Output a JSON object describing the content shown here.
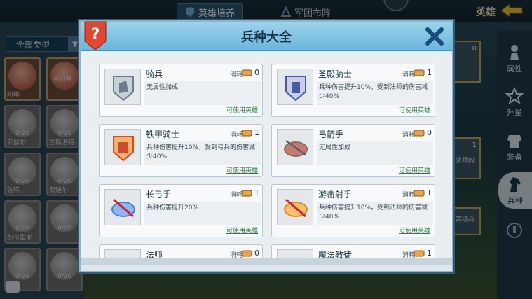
{
  "top_tabs": [
    {
      "label": "英雄培养",
      "icon": "shield-icon",
      "active": true
    },
    {
      "label": "军团布阵",
      "icon": "formation-icon",
      "active": false
    }
  ],
  "hero_title": "英雄",
  "filter": {
    "label": "全部类型"
  },
  "hero_cards": [
    {
      "name": "阿琳",
      "level": "",
      "highlight": true
    },
    {
      "name": "",
      "level": "可召唤",
      "highlight": true
    },
    {
      "name": "",
      "level": "0/20"
    },
    {
      "name": "",
      "level": "0/20"
    },
    {
      "name": "亚瑟尔",
      "level": "0/20"
    },
    {
      "name": "兰斯洛特",
      "level": "0/20"
    },
    {
      "name": "佐鸣",
      "level": "0/20"
    },
    {
      "name": "费迪尔",
      "level": "0/20"
    },
    {
      "name": "加布里耶",
      "level": "0/20"
    },
    {
      "name": "",
      "level": "0/20"
    }
  ],
  "right_nav": [
    {
      "label": "属性",
      "icon": "pawn-icon"
    },
    {
      "label": "升星",
      "icon": "star-icon"
    },
    {
      "label": "装备",
      "icon": "armor-icon"
    },
    {
      "label": "兵种",
      "icon": "horse-icon",
      "active": true
    }
  ],
  "modal": {
    "title": "兵种大全",
    "cost_label": "消耗",
    "usable_label": "可使用英雄",
    "units": [
      {
        "name": "骑兵",
        "cost": "0",
        "desc": "无属性加成",
        "icon": "knight-helmet-icon",
        "color": "#6b7c8a"
      },
      {
        "name": "圣殿骑士",
        "cost": "1",
        "desc": "兵种伤害提升10%，受到法师的伤害减少40%",
        "icon": "templar-icon",
        "color": "#4b5aa0"
      },
      {
        "name": "铁甲骑士",
        "cost": "1",
        "desc": "兵种伤害提升10%，受到弓兵的伤害减少40%",
        "icon": "ironclad-icon",
        "color": "#d24a2e"
      },
      {
        "name": "弓箭手",
        "cost": "0",
        "desc": "无属性加成",
        "icon": "archer-icon",
        "color": "#8b6a6a"
      },
      {
        "name": "长弓手",
        "cost": "1",
        "desc": "兵种伤害提升20%",
        "icon": "longbow-icon",
        "color": "#4a7fd2"
      },
      {
        "name": "游击射手",
        "cost": "1",
        "desc": "兵种伤害提升10%，受到法师的伤害减少40%",
        "icon": "ranger-icon",
        "color": "#e2892a"
      },
      {
        "name": "法师",
        "cost": "0",
        "desc": "",
        "icon": "mage-icon",
        "color": "#7a7a7a"
      },
      {
        "name": "魔法教徒",
        "cost": "1",
        "desc": "",
        "icon": "cultist-icon",
        "color": "#7a7a7a"
      }
    ]
  },
  "sidebar_fragments": [
    "0",
    "1",
    "法师的",
    "高级兵"
  ]
}
